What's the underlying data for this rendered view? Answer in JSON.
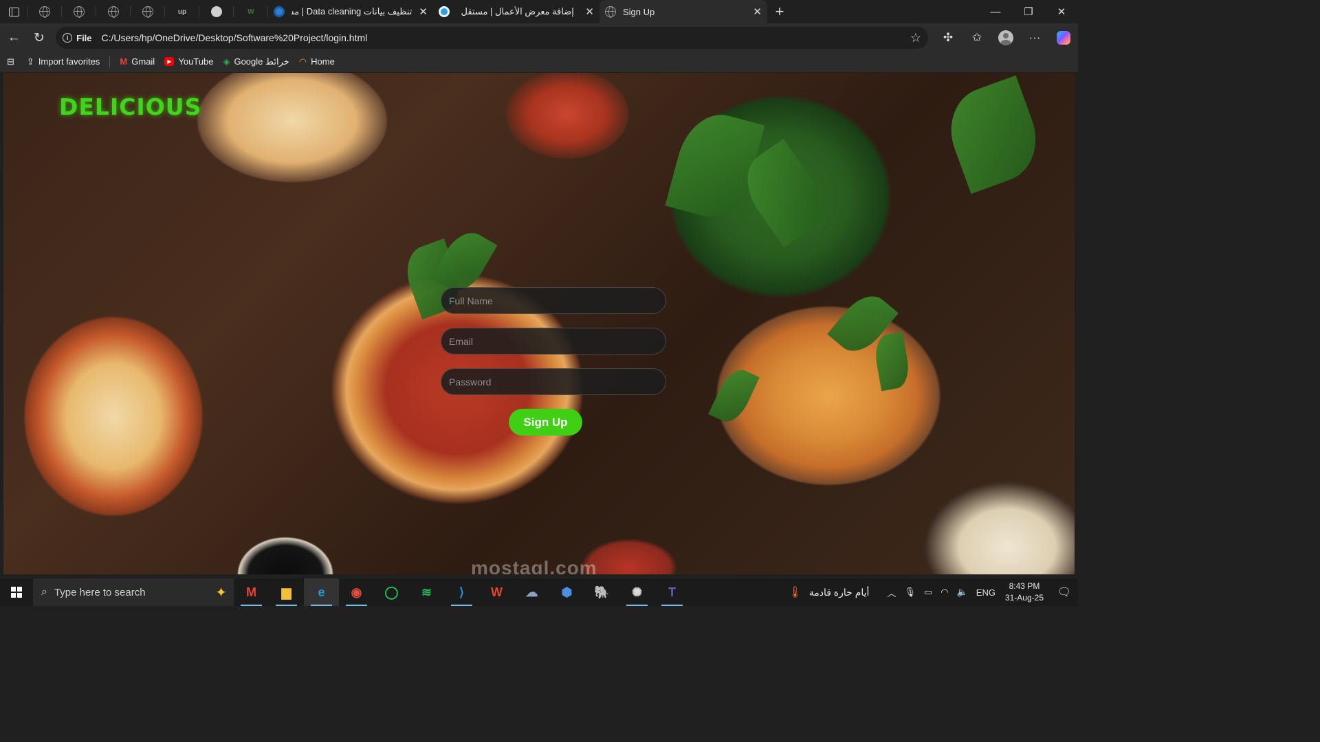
{
  "browser": {
    "tabs": [
      {
        "title": "تنظيف بيانات Data cleaning | مستقل",
        "favicon_color": "#2d7fd6"
      },
      {
        "title": "إضافة معرض الأعمال | مستقل",
        "favicon_color": "#2d9fe6"
      },
      {
        "title": "Sign Up",
        "favicon_color": "#9a9a9a"
      }
    ],
    "pinned_icons": [
      "globe-icon",
      "globe-icon",
      "globe-icon",
      "globe-icon",
      "upwork-icon",
      "github-icon",
      "wuzzuf-icon"
    ],
    "pinned_labels": {
      "upwork": "up",
      "wuzzuf": "W"
    },
    "address": {
      "scheme_label": "File",
      "url": "C:/Users/hp/OneDrive/Desktop/Software%20Project/login.html"
    },
    "favorites": {
      "import": "Import favorites",
      "items": [
        {
          "label": "Gmail",
          "icon": "gmail-icon",
          "color": "#ea4335"
        },
        {
          "label": "YouTube",
          "icon": "youtube-icon",
          "color": "#ff0000"
        },
        {
          "label": "Google خرائط",
          "icon": "maps-icon",
          "color": "#34a853"
        },
        {
          "label": "Home",
          "icon": "home-icon",
          "color": "#f08a24"
        }
      ]
    }
  },
  "page": {
    "brand": "DELICIOUS",
    "brand_color": "#3fd61a",
    "form": {
      "full_name_placeholder": "Full Name",
      "email_placeholder": "Email",
      "password_placeholder": "Password",
      "submit_label": "Sign Up",
      "accent": "#3fcf14"
    },
    "watermark": "mostaql.com"
  },
  "taskbar": {
    "search_placeholder": "Type here to search",
    "apps": [
      {
        "name": "gmail-app-icon",
        "glyph": "M",
        "color": "#ea4335"
      },
      {
        "name": "file-explorer-icon",
        "glyph": "▆",
        "color": "#f3c03a"
      },
      {
        "name": "edge-icon",
        "glyph": "e",
        "color": "#1f9ad8"
      },
      {
        "name": "chrome-icon",
        "glyph": "◉",
        "color": "#e24a3b"
      },
      {
        "name": "status-ring-icon",
        "glyph": "◯",
        "color": "#21c45d"
      },
      {
        "name": "spotify-icon",
        "glyph": "≋",
        "color": "#1db954"
      },
      {
        "name": "vscode-icon",
        "glyph": "⟩",
        "color": "#2b8ee0"
      },
      {
        "name": "brave-icon",
        "glyph": "W",
        "color": "#e5462d"
      },
      {
        "name": "weather-app-icon",
        "glyph": "☁",
        "color": "#8aa3c0"
      },
      {
        "name": "cube-app-icon",
        "glyph": "⬢",
        "color": "#4d8fe0"
      },
      {
        "name": "postgres-icon",
        "glyph": "🐘",
        "color": "#4c7bbf"
      },
      {
        "name": "chatgpt-icon",
        "glyph": "✺",
        "color": "#d8d8d8"
      },
      {
        "name": "teams-icon",
        "glyph": "T",
        "color": "#5b5fc7"
      }
    ],
    "weather": "أيام حارة قادمة",
    "language": "ENG",
    "time": "8:43 PM",
    "date": "31-Aug-25"
  }
}
